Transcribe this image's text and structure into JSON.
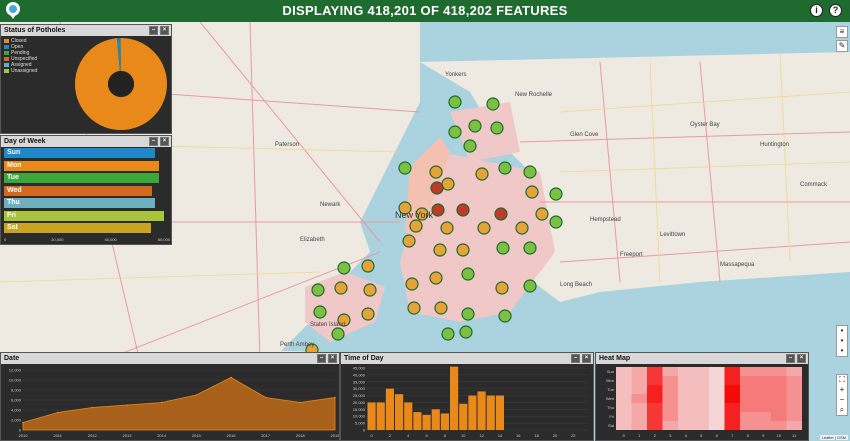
{
  "header": {
    "title": "DISPLAYING 418,201 OF 418,202 FEATURES",
    "icons": [
      "info-icon",
      "help-icon"
    ],
    "info_glyph": "i",
    "help_glyph": "?"
  },
  "colors": {
    "header_bg": "#1f6a2e",
    "panel_bg": "#2b2b2b",
    "closed": "#e8891a",
    "open": "#1e88c8",
    "pending": "#3ca83c",
    "unspecified": "#d2691e",
    "assigned": "#5bb0c8",
    "unassigned": "#a8c43a"
  },
  "status_panel": {
    "title": "Status of Potholes",
    "legend": [
      {
        "label": "Closed",
        "color": "#e8891a"
      },
      {
        "label": "Open",
        "color": "#1e88c8"
      },
      {
        "label": "Pending",
        "color": "#3ca83c"
      },
      {
        "label": "Unspecified",
        "color": "#d2691e"
      },
      {
        "label": "Assigned",
        "color": "#5bb0c8"
      },
      {
        "label": "Unassigned",
        "color": "#a8c43a"
      }
    ]
  },
  "dow_panel": {
    "title": "Day of Week",
    "ticks": [
      "0",
      "20,000",
      "40,000",
      "60,000"
    ],
    "colors": [
      "#1e88c8",
      "#e8891a",
      "#3ca83c",
      "#d2691e",
      "#6fb0c0",
      "#a8c43a",
      "#c8a420"
    ]
  },
  "date_panel": {
    "title": "Date",
    "y_ticks": [
      "12,000",
      "10,000",
      "8,000",
      "6,000",
      "4,000",
      "2,000",
      "0"
    ],
    "x_ticks": [
      "2010",
      "2011",
      "2012",
      "2013",
      "2014",
      "2015",
      "2016",
      "2017",
      "2018",
      "2019"
    ]
  },
  "tod_panel": {
    "title": "Time of Day",
    "y_ticks": [
      "45,000",
      "40,000",
      "35,000",
      "30,000",
      "25,000",
      "20,000",
      "15,000",
      "10,000",
      "5,000",
      "0"
    ],
    "x_ticks": [
      "0",
      "2",
      "4",
      "6",
      "8",
      "10",
      "12",
      "14",
      "16",
      "18",
      "20",
      "22"
    ]
  },
  "heat_panel": {
    "title": "Heat Map",
    "rows": [
      "Sun",
      "Mon",
      "Tue",
      "Wed",
      "Thu",
      "Fri",
      "Sat"
    ],
    "x_ticks": [
      "0",
      "1",
      "2",
      "3",
      "4",
      "5",
      "6",
      "7",
      "8",
      "9",
      "10",
      "11"
    ]
  },
  "map": {
    "city_label": "New York",
    "places": [
      "Paterson",
      "Newark",
      "Elizabeth",
      "Yonkers",
      "New Rochelle",
      "Hempstead",
      "Freeport",
      "Long Beach",
      "Glen Cove",
      "Huntington",
      "Levittown",
      "Perth Amboy",
      "Staten Island",
      "Oyster Bay",
      "Massapequa",
      "Commack"
    ],
    "attribution": "Leaflet | OSM"
  },
  "chart_data": [
    {
      "type": "pie",
      "title": "Status of Potholes",
      "categories": [
        "Closed",
        "Open",
        "Pending",
        "Unspecified",
        "Assigned",
        "Unassigned"
      ],
      "values": [
        98.6,
        1.0,
        0.1,
        0.1,
        0.1,
        0.1
      ]
    },
    {
      "type": "bar",
      "title": "Day of Week",
      "categories": [
        "Sun",
        "Mon",
        "Tue",
        "Wed",
        "Thu",
        "Fri",
        "Sat"
      ],
      "values": [
        56500,
        58000,
        58200,
        55500,
        56500,
        60000,
        55000
      ],
      "xlim": [
        0,
        60000
      ]
    },
    {
      "type": "area",
      "title": "Date",
      "x": [
        "2010",
        "2011",
        "2012",
        "2013",
        "2014",
        "2015",
        "2016",
        "2017",
        "2018",
        "2019"
      ],
      "values": [
        1500,
        3500,
        4500,
        5000,
        5500,
        7000,
        10500,
        6500,
        5500,
        6500
      ],
      "ylim": [
        0,
        12000
      ]
    },
    {
      "type": "bar",
      "title": "Time of Day",
      "categories": [
        "0",
        "1",
        "2",
        "3",
        "4",
        "5",
        "6",
        "7",
        "8",
        "9",
        "10",
        "11",
        "12",
        "13",
        "14",
        "15",
        "16",
        "17",
        "18",
        "19",
        "20",
        "21",
        "22",
        "23"
      ],
      "values": [
        20000,
        20000,
        30000,
        26000,
        20000,
        13000,
        11000,
        15000,
        12000,
        46000,
        19000,
        25000,
        28000,
        25000,
        25000,
        0,
        0,
        0,
        0,
        0,
        0,
        0,
        0,
        0
      ],
      "ylim": [
        0,
        45000
      ]
    },
    {
      "type": "heatmap",
      "title": "Heat Map",
      "rows": [
        "Sun",
        "Mon",
        "Tue",
        "Wed",
        "Thu",
        "Fri",
        "Sat"
      ],
      "columns": [
        "0",
        "1",
        "2",
        "3",
        "4",
        "5",
        "6",
        "7",
        "8",
        "9",
        "10",
        "11"
      ],
      "values": [
        [
          0.2,
          0.3,
          0.8,
          0.3,
          0.2,
          0.2,
          0.1,
          0.9,
          0.4,
          0.4,
          0.4,
          0.3
        ],
        [
          0.2,
          0.3,
          0.8,
          0.4,
          0.2,
          0.2,
          0.1,
          0.9,
          0.5,
          0.5,
          0.5,
          0.4
        ],
        [
          0.2,
          0.3,
          0.9,
          0.4,
          0.2,
          0.2,
          0.1,
          1.0,
          0.5,
          0.5,
          0.5,
          0.4
        ],
        [
          0.2,
          0.4,
          0.9,
          0.4,
          0.2,
          0.2,
          0.1,
          1.0,
          0.5,
          0.5,
          0.5,
          0.4
        ],
        [
          0.2,
          0.3,
          0.8,
          0.4,
          0.2,
          0.2,
          0.1,
          0.9,
          0.5,
          0.5,
          0.5,
          0.4
        ],
        [
          0.2,
          0.3,
          0.8,
          0.4,
          0.2,
          0.2,
          0.1,
          0.9,
          0.4,
          0.4,
          0.5,
          0.4
        ],
        [
          0.2,
          0.3,
          0.8,
          0.3,
          0.2,
          0.2,
          0.1,
          0.9,
          0.4,
          0.4,
          0.4,
          0.3
        ]
      ]
    }
  ]
}
